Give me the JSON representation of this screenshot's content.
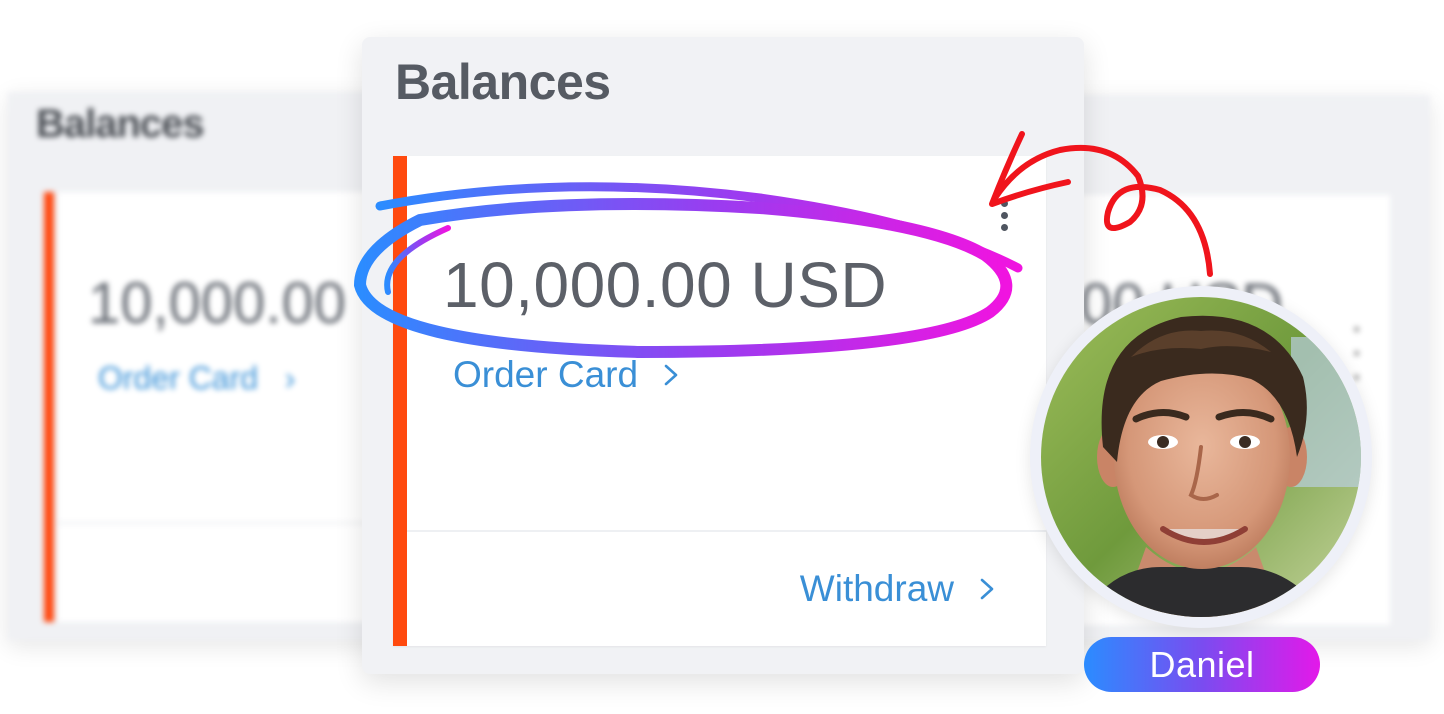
{
  "background_left": {
    "title": "Balances",
    "amount": "10,000.00",
    "link": "Order Card"
  },
  "background_right": {
    "amount": "00 USD"
  },
  "balances": {
    "title": "Balances",
    "card": {
      "amount": "10,000.00 USD",
      "order_link": "Order Card",
      "withdraw_link": "Withdraw",
      "accent_color": "#ff4a0e",
      "link_color": "#3a8fd6"
    }
  },
  "annotation": {
    "highlight_gradient": [
      "#2b8cff",
      "#e319e9"
    ],
    "arrow_color": "#f0141c"
  },
  "user": {
    "name": "Daniel"
  },
  "icons": {
    "kebab": "more-vertical-icon",
    "chevron": "chevron-right-icon"
  }
}
